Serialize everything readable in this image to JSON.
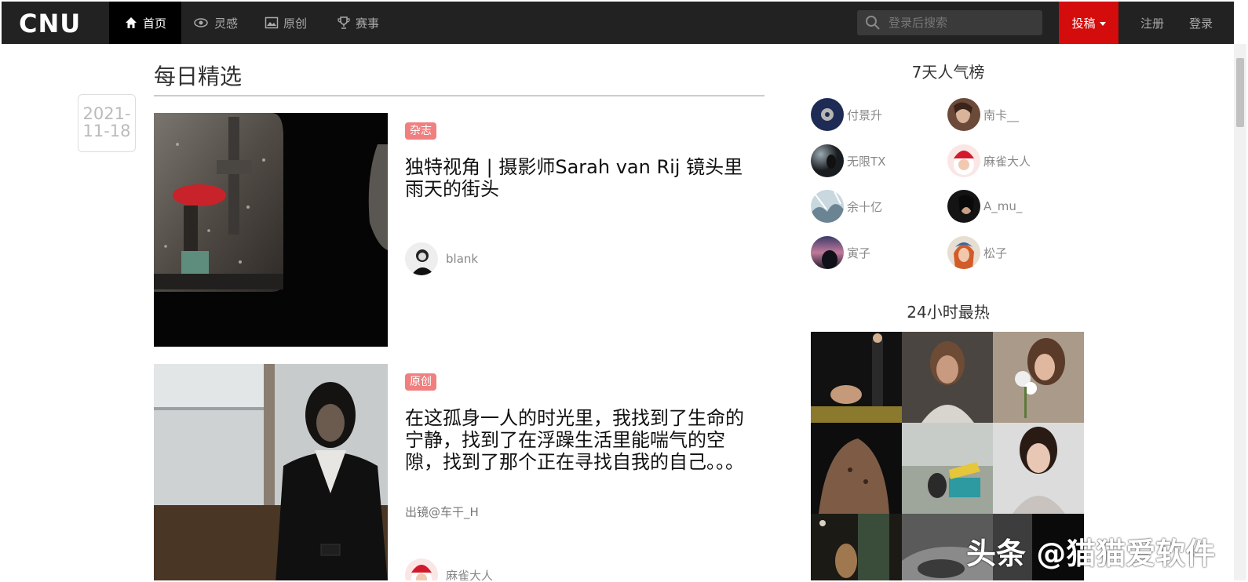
{
  "nav": {
    "logo": "CNU",
    "items": [
      {
        "label": "首页",
        "icon": "home-icon",
        "active": true
      },
      {
        "label": "灵感",
        "icon": "eye-icon",
        "active": false
      },
      {
        "label": "原创",
        "icon": "image-icon",
        "active": false
      },
      {
        "label": "赛事",
        "icon": "trophy-icon",
        "active": false
      }
    ],
    "search_placeholder": "登录后搜索",
    "submit_label": "投稿",
    "register_label": "注册",
    "login_label": "登录"
  },
  "main": {
    "section_title": "每日精选",
    "date_line1": "2021-",
    "date_line2": "11-18",
    "cards": [
      {
        "tag": "杂志",
        "title": "独特视角 | 摄影师Sarah van Rij 镜头里雨天的街头",
        "subtitle": "",
        "author": "blank"
      },
      {
        "tag": "原创",
        "title": "在这孤身一人的时光里，我找到了生命的宁静，找到了在浮躁生活里能喘气的空隙，找到了那个正在寻找自我的自己。。。",
        "subtitle": "出镜@车干_H",
        "author": "麻雀大人"
      }
    ]
  },
  "sidebar": {
    "rank_title": "7天人气榜",
    "rank": [
      "付景升",
      "南卡__",
      "无限TX",
      "麻雀大人",
      "余十亿",
      "A_mu_",
      "寅子",
      "松子"
    ],
    "hot_title": "24小时最热"
  },
  "watermark": "头条 @猫猫爱软件",
  "colors": {
    "nav_bg": "#222222",
    "accent_red": "#d40c0c",
    "tag_bg": "#f08080"
  }
}
